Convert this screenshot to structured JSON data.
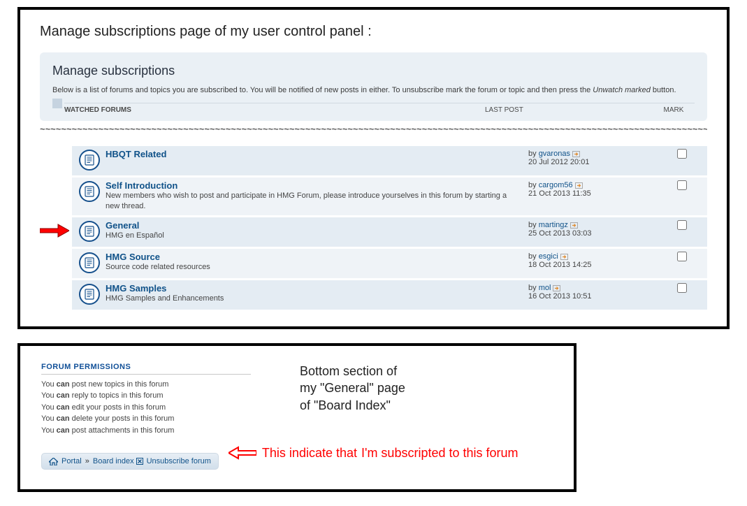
{
  "top": {
    "heading": "Manage subscriptions page of my user control panel :",
    "panel_title": "Manage subscriptions",
    "description_prefix": "Below is a list of forums and topics you are subscribed to. You will be notified of new posts in either. To unsubscribe mark the forum or topic and then press the ",
    "description_em": "Unwatch marked",
    "description_suffix": " button.",
    "col_main": "WATCHED FORUMS",
    "col_last": "LAST POST",
    "col_mark": "MARK"
  },
  "rows": [
    {
      "title": "HBQT Related",
      "desc": "",
      "by": "by ",
      "author": "gvaronas",
      "date": "20 Jul 2012 20:01",
      "alt": true,
      "arrow": false
    },
    {
      "title": "Self Introduction",
      "desc": "New members who wish to post and participate in HMG Forum, please introduce yourselves in this forum by starting a new thread.",
      "by": "by ",
      "author": "cargom56",
      "date": "21 Oct 2013 11:35",
      "alt": false,
      "arrow": false
    },
    {
      "title": "General",
      "desc": "HMG en Español",
      "by": "by ",
      "author": "martingz",
      "date": "25 Oct 2013 03:03",
      "alt": true,
      "arrow": true
    },
    {
      "title": "HMG Source",
      "desc": "Source code related resources",
      "by": "by ",
      "author": "esgici",
      "date": "18 Oct 2013 14:25",
      "alt": false,
      "arrow": false
    },
    {
      "title": "HMG Samples",
      "desc": "HMG Samples and Enhancements",
      "by": "by ",
      "author": "mol",
      "date": "16 Oct 2013 10:51",
      "alt": true,
      "arrow": false
    }
  ],
  "perm": {
    "title": "FORUM PERMISSIONS",
    "lines": [
      {
        "pre": "You ",
        "b": "can",
        "post": " post new topics in this forum"
      },
      {
        "pre": "You ",
        "b": "can",
        "post": " reply to topics in this forum"
      },
      {
        "pre": "You ",
        "b": "can",
        "post": " edit your posts in this forum"
      },
      {
        "pre": "You ",
        "b": "can",
        "post": " delete your posts in this forum"
      },
      {
        "pre": "You ",
        "b": "can",
        "post": " post attachments in this forum"
      }
    ]
  },
  "bc": {
    "portal": "Portal",
    "board": "Board index",
    "unsub": "Unsubscribe forum"
  },
  "annot2": {
    "line1": "Bottom section of",
    "line2": "my \"General\" page",
    "line3": "of \"Board Index\"",
    "red1": "This indicate that",
    "red2": "I'm subscripted to this forum"
  }
}
